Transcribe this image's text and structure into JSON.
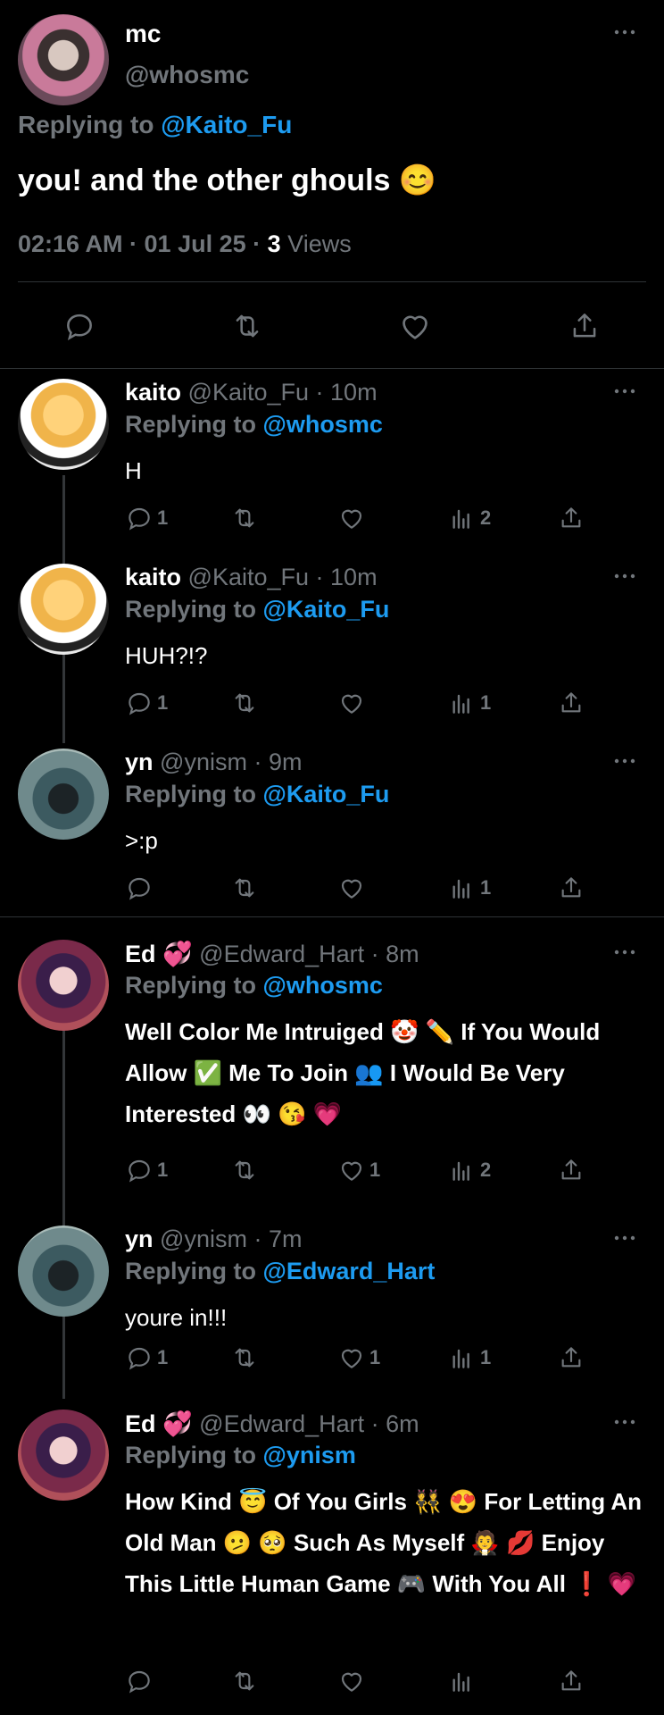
{
  "main_tweet": {
    "name": "mc",
    "handle": "@whosmc",
    "replying_label": "Replying to",
    "replying_to": "@Kaito_Fu",
    "text": "you! and the other ghouls",
    "emoji": "😊",
    "time": "02:16 AM · 01 Jul 25 ·",
    "views_count": "3",
    "views_label": "Views"
  },
  "replies": [
    {
      "name": "kaito",
      "badge": "",
      "handle": "@Kaito_Fu",
      "time": "· 10m",
      "replying_to": "@whosmc",
      "text": "H",
      "replies": "1",
      "retweets": "",
      "likes": "",
      "views": "2"
    },
    {
      "name": "kaito",
      "badge": "",
      "handle": "@Kaito_Fu",
      "time": "· 10m",
      "replying_to": "@Kaito_Fu",
      "text": "HUH?!?",
      "replies": "1",
      "retweets": "",
      "likes": "",
      "views": "1"
    },
    {
      "name": "yn",
      "badge": "",
      "handle": "@ynism",
      "time": "· 9m",
      "replying_to": "@Kaito_Fu",
      "text": ">:p",
      "replies": "",
      "retweets": "",
      "likes": "",
      "views": "1"
    },
    {
      "name": "Ed",
      "badge": "💞",
      "handle": "@Edward_Hart",
      "time": "· 8m",
      "replying_to": "@whosmc",
      "text": "Well Color Me Intruiged 🤡 ✏️ If You Would Allow ✅ Me To Join 👥 I Would Be Very Interested 👀 😘 💗",
      "replies": "1",
      "retweets": "",
      "likes": "1",
      "views": "2"
    },
    {
      "name": "yn",
      "badge": "",
      "handle": "@ynism",
      "time": "· 7m",
      "replying_to": "@Edward_Hart",
      "text": "youre in!!!",
      "replies": "1",
      "retweets": "",
      "likes": "1",
      "views": "1"
    },
    {
      "name": "Ed",
      "badge": "💞",
      "handle": "@Edward_Hart",
      "time": "· 6m",
      "replying_to": "@ynism",
      "text": "How Kind 😇 Of You Girls 👯 😍 For Letting An Old Man 🫤 🥺 Such As Myself 🧛 💋 Enjoy This Little Human Game 🎮 With You All ❗ 💗",
      "replies": "",
      "retweets": "",
      "likes": "",
      "views": ""
    }
  ],
  "common": {
    "replying_label": "Replying to"
  },
  "colors": {
    "background": "#000000",
    "accent": "#1d9bf0",
    "muted": "#71767b",
    "divider": "#2f3336"
  },
  "icons": [
    "reply-icon",
    "retweet-icon",
    "like-icon",
    "views-icon",
    "share-icon",
    "more-icon"
  ]
}
